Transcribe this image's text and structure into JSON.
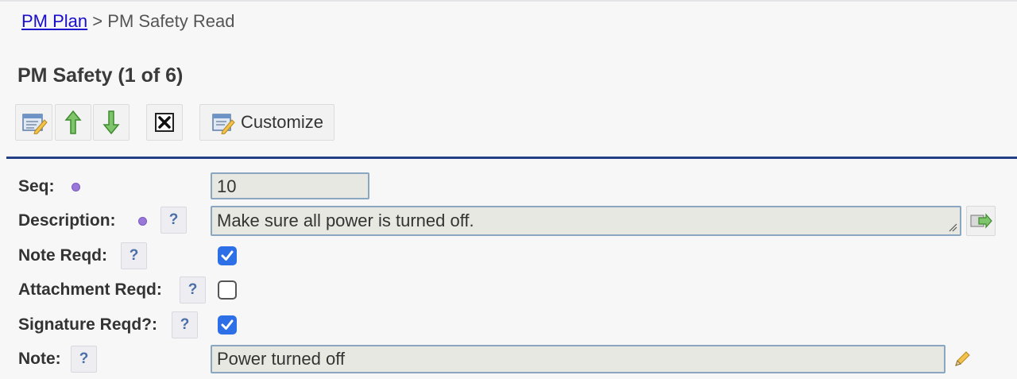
{
  "breadcrumb": {
    "parent_link": "PM Plan",
    "separator": ">",
    "current": "PM Safety Read"
  },
  "page": {
    "title": "PM Safety (1 of 6)"
  },
  "toolbar": {
    "customize_label": "Customize",
    "icons": [
      "edit-form-icon",
      "arrow-up-icon",
      "arrow-down-icon",
      "delete-icon",
      "customize-icon"
    ]
  },
  "form": {
    "seq": {
      "label": "Seq:",
      "value": "10",
      "required": true
    },
    "description": {
      "label": "Description:",
      "value": "Make sure all power is turned off.",
      "required": true,
      "help": "?"
    },
    "note_reqd": {
      "label": "Note Reqd:",
      "checked": true,
      "help": "?"
    },
    "attachment_reqd": {
      "label": "Attachment Reqd:",
      "checked": false,
      "help": "?"
    },
    "signature_reqd": {
      "label": "Signature Reqd?:",
      "checked": true,
      "help": "?"
    },
    "note": {
      "label": "Note:",
      "value": "Power turned off",
      "help": "?"
    }
  },
  "colors": {
    "divider": "#233f86",
    "link": "#1a0dcc",
    "required_dot": "#9a78d8",
    "checkbox_checked": "#2d6fe6"
  }
}
